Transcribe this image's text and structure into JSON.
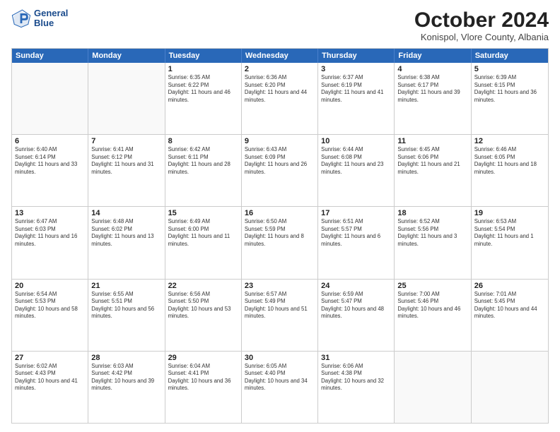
{
  "header": {
    "logo_line1": "General",
    "logo_line2": "Blue",
    "month_title": "October 2024",
    "location": "Konispol, Vlore County, Albania"
  },
  "weekdays": [
    "Sunday",
    "Monday",
    "Tuesday",
    "Wednesday",
    "Thursday",
    "Friday",
    "Saturday"
  ],
  "weeks": [
    [
      {
        "day": "",
        "info": ""
      },
      {
        "day": "",
        "info": ""
      },
      {
        "day": "1",
        "info": "Sunrise: 6:35 AM\nSunset: 6:22 PM\nDaylight: 11 hours and 46 minutes."
      },
      {
        "day": "2",
        "info": "Sunrise: 6:36 AM\nSunset: 6:20 PM\nDaylight: 11 hours and 44 minutes."
      },
      {
        "day": "3",
        "info": "Sunrise: 6:37 AM\nSunset: 6:19 PM\nDaylight: 11 hours and 41 minutes."
      },
      {
        "day": "4",
        "info": "Sunrise: 6:38 AM\nSunset: 6:17 PM\nDaylight: 11 hours and 39 minutes."
      },
      {
        "day": "5",
        "info": "Sunrise: 6:39 AM\nSunset: 6:15 PM\nDaylight: 11 hours and 36 minutes."
      }
    ],
    [
      {
        "day": "6",
        "info": "Sunrise: 6:40 AM\nSunset: 6:14 PM\nDaylight: 11 hours and 33 minutes."
      },
      {
        "day": "7",
        "info": "Sunrise: 6:41 AM\nSunset: 6:12 PM\nDaylight: 11 hours and 31 minutes."
      },
      {
        "day": "8",
        "info": "Sunrise: 6:42 AM\nSunset: 6:11 PM\nDaylight: 11 hours and 28 minutes."
      },
      {
        "day": "9",
        "info": "Sunrise: 6:43 AM\nSunset: 6:09 PM\nDaylight: 11 hours and 26 minutes."
      },
      {
        "day": "10",
        "info": "Sunrise: 6:44 AM\nSunset: 6:08 PM\nDaylight: 11 hours and 23 minutes."
      },
      {
        "day": "11",
        "info": "Sunrise: 6:45 AM\nSunset: 6:06 PM\nDaylight: 11 hours and 21 minutes."
      },
      {
        "day": "12",
        "info": "Sunrise: 6:46 AM\nSunset: 6:05 PM\nDaylight: 11 hours and 18 minutes."
      }
    ],
    [
      {
        "day": "13",
        "info": "Sunrise: 6:47 AM\nSunset: 6:03 PM\nDaylight: 11 hours and 16 minutes."
      },
      {
        "day": "14",
        "info": "Sunrise: 6:48 AM\nSunset: 6:02 PM\nDaylight: 11 hours and 13 minutes."
      },
      {
        "day": "15",
        "info": "Sunrise: 6:49 AM\nSunset: 6:00 PM\nDaylight: 11 hours and 11 minutes."
      },
      {
        "day": "16",
        "info": "Sunrise: 6:50 AM\nSunset: 5:59 PM\nDaylight: 11 hours and 8 minutes."
      },
      {
        "day": "17",
        "info": "Sunrise: 6:51 AM\nSunset: 5:57 PM\nDaylight: 11 hours and 6 minutes."
      },
      {
        "day": "18",
        "info": "Sunrise: 6:52 AM\nSunset: 5:56 PM\nDaylight: 11 hours and 3 minutes."
      },
      {
        "day": "19",
        "info": "Sunrise: 6:53 AM\nSunset: 5:54 PM\nDaylight: 11 hours and 1 minute."
      }
    ],
    [
      {
        "day": "20",
        "info": "Sunrise: 6:54 AM\nSunset: 5:53 PM\nDaylight: 10 hours and 58 minutes."
      },
      {
        "day": "21",
        "info": "Sunrise: 6:55 AM\nSunset: 5:51 PM\nDaylight: 10 hours and 56 minutes."
      },
      {
        "day": "22",
        "info": "Sunrise: 6:56 AM\nSunset: 5:50 PM\nDaylight: 10 hours and 53 minutes."
      },
      {
        "day": "23",
        "info": "Sunrise: 6:57 AM\nSunset: 5:49 PM\nDaylight: 10 hours and 51 minutes."
      },
      {
        "day": "24",
        "info": "Sunrise: 6:59 AM\nSunset: 5:47 PM\nDaylight: 10 hours and 48 minutes."
      },
      {
        "day": "25",
        "info": "Sunrise: 7:00 AM\nSunset: 5:46 PM\nDaylight: 10 hours and 46 minutes."
      },
      {
        "day": "26",
        "info": "Sunrise: 7:01 AM\nSunset: 5:45 PM\nDaylight: 10 hours and 44 minutes."
      }
    ],
    [
      {
        "day": "27",
        "info": "Sunrise: 6:02 AM\nSunset: 4:43 PM\nDaylight: 10 hours and 41 minutes."
      },
      {
        "day": "28",
        "info": "Sunrise: 6:03 AM\nSunset: 4:42 PM\nDaylight: 10 hours and 39 minutes."
      },
      {
        "day": "29",
        "info": "Sunrise: 6:04 AM\nSunset: 4:41 PM\nDaylight: 10 hours and 36 minutes."
      },
      {
        "day": "30",
        "info": "Sunrise: 6:05 AM\nSunset: 4:40 PM\nDaylight: 10 hours and 34 minutes."
      },
      {
        "day": "31",
        "info": "Sunrise: 6:06 AM\nSunset: 4:38 PM\nDaylight: 10 hours and 32 minutes."
      },
      {
        "day": "",
        "info": ""
      },
      {
        "day": "",
        "info": ""
      }
    ]
  ]
}
